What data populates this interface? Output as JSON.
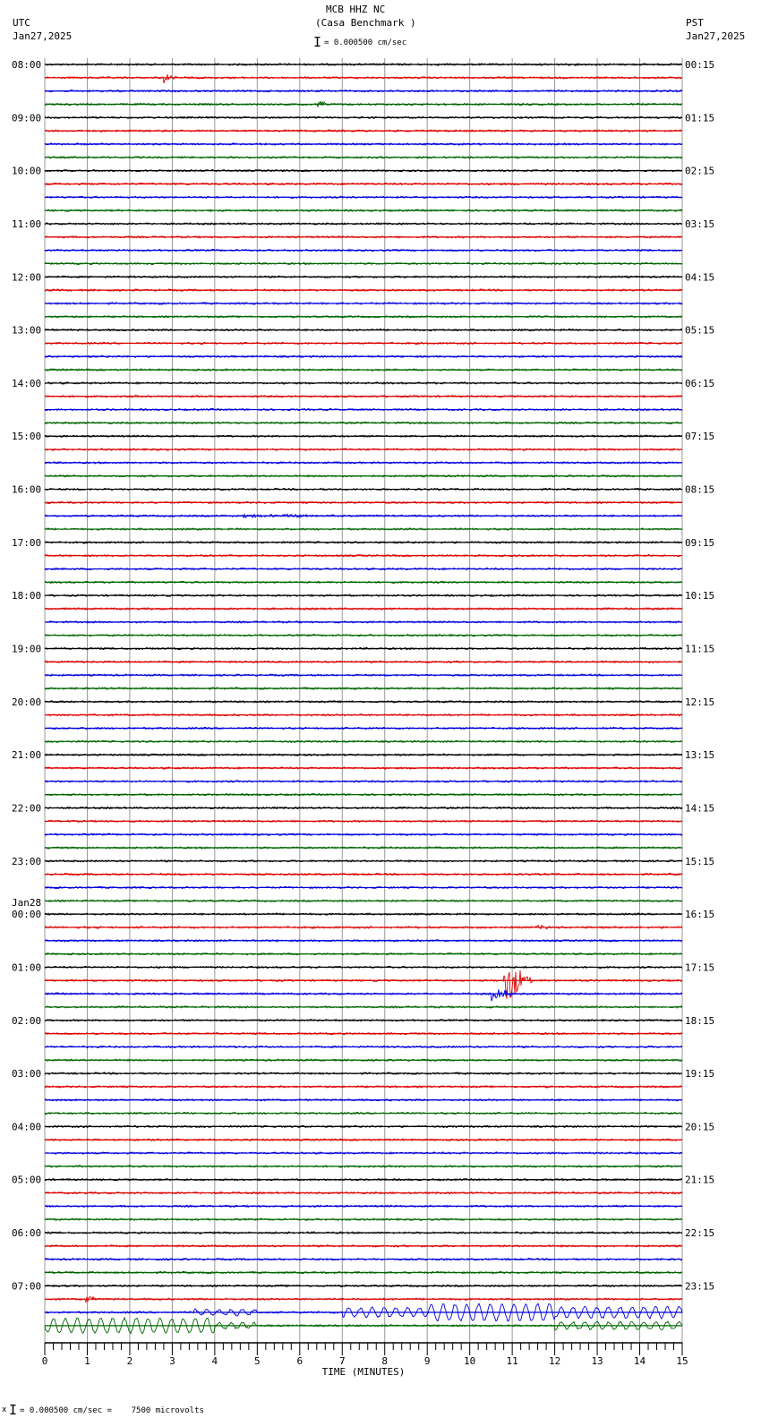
{
  "header": {
    "station": "MCB HHZ NC",
    "location": "(Casa Benchmark )",
    "left_tz": "UTC",
    "left_date": "Jan27,2025",
    "right_tz": "PST",
    "right_date": "Jan27,2025",
    "scale": "= 0.000500 cm/sec"
  },
  "footer": {
    "scale_note": "= 0.000500 cm/sec =    7500 microvolts"
  },
  "chart_data": {
    "type": "line",
    "title": "MCB HHZ NC (Casa Benchmark )",
    "xlabel": "TIME (MINUTES)",
    "xlim": [
      0,
      15
    ],
    "xticks": [
      "0",
      "1",
      "2",
      "3",
      "4",
      "5",
      "6",
      "7",
      "8",
      "9",
      "10",
      "11",
      "12",
      "13",
      "14",
      "15"
    ],
    "traces_per_hour": 4,
    "trace_count": 96,
    "trace_colors": [
      "#000000",
      "#dd0000",
      "#0000dd",
      "#006600"
    ],
    "left_labels": [
      {
        "trace": 0,
        "text": "08:00"
      },
      {
        "trace": 4,
        "text": "09:00"
      },
      {
        "trace": 8,
        "text": "10:00"
      },
      {
        "trace": 12,
        "text": "11:00"
      },
      {
        "trace": 16,
        "text": "12:00"
      },
      {
        "trace": 20,
        "text": "13:00"
      },
      {
        "trace": 24,
        "text": "14:00"
      },
      {
        "trace": 28,
        "text": "15:00"
      },
      {
        "trace": 32,
        "text": "16:00"
      },
      {
        "trace": 36,
        "text": "17:00"
      },
      {
        "trace": 40,
        "text": "18:00"
      },
      {
        "trace": 44,
        "text": "19:00"
      },
      {
        "trace": 48,
        "text": "20:00"
      },
      {
        "trace": 52,
        "text": "21:00"
      },
      {
        "trace": 56,
        "text": "22:00"
      },
      {
        "trace": 60,
        "text": "23:00"
      },
      {
        "trace": 64,
        "text": "00:00",
        "date": "Jan28"
      },
      {
        "trace": 68,
        "text": "01:00"
      },
      {
        "trace": 72,
        "text": "02:00"
      },
      {
        "trace": 76,
        "text": "03:00"
      },
      {
        "trace": 80,
        "text": "04:00"
      },
      {
        "trace": 84,
        "text": "05:00"
      },
      {
        "trace": 88,
        "text": "06:00"
      },
      {
        "trace": 92,
        "text": "07:00"
      }
    ],
    "right_labels": [
      "00:15",
      "01:15",
      "02:15",
      "03:15",
      "04:15",
      "05:15",
      "06:15",
      "07:15",
      "08:15",
      "09:15",
      "10:15",
      "11:15",
      "12:15",
      "13:15",
      "14:15",
      "15:15",
      "16:15",
      "17:15",
      "18:15",
      "19:15",
      "20:15",
      "21:15",
      "22:15",
      "23:15"
    ],
    "events": [
      {
        "trace": 1,
        "minute": 2.8,
        "duration": 0.3,
        "amplitude": 6
      },
      {
        "trace": 3,
        "minute": 6.4,
        "duration": 0.3,
        "amplitude": 8
      },
      {
        "trace": 34,
        "minute": 4.6,
        "duration": 3.0,
        "amplitude": 2
      },
      {
        "trace": 65,
        "minute": 11.6,
        "duration": 0.5,
        "amplitude": 2
      },
      {
        "trace": 69,
        "minute": 10.8,
        "duration": 0.7,
        "amplitude": 26
      },
      {
        "trace": 70,
        "minute": 10.5,
        "duration": 0.6,
        "amplitude": 8
      },
      {
        "trace": 93,
        "minute": 0.95,
        "duration": 0.3,
        "amplitude": 5
      }
    ],
    "long_period": [
      {
        "trace": 94,
        "segments": [
          [
            3.5,
            5,
            3
          ],
          [
            7,
            9,
            5
          ],
          [
            9,
            12,
            9
          ],
          [
            12,
            15,
            6
          ]
        ]
      },
      {
        "trace": 95,
        "segments": [
          [
            0,
            4,
            8
          ],
          [
            4,
            5,
            3
          ],
          [
            12,
            15,
            4
          ]
        ]
      }
    ]
  }
}
